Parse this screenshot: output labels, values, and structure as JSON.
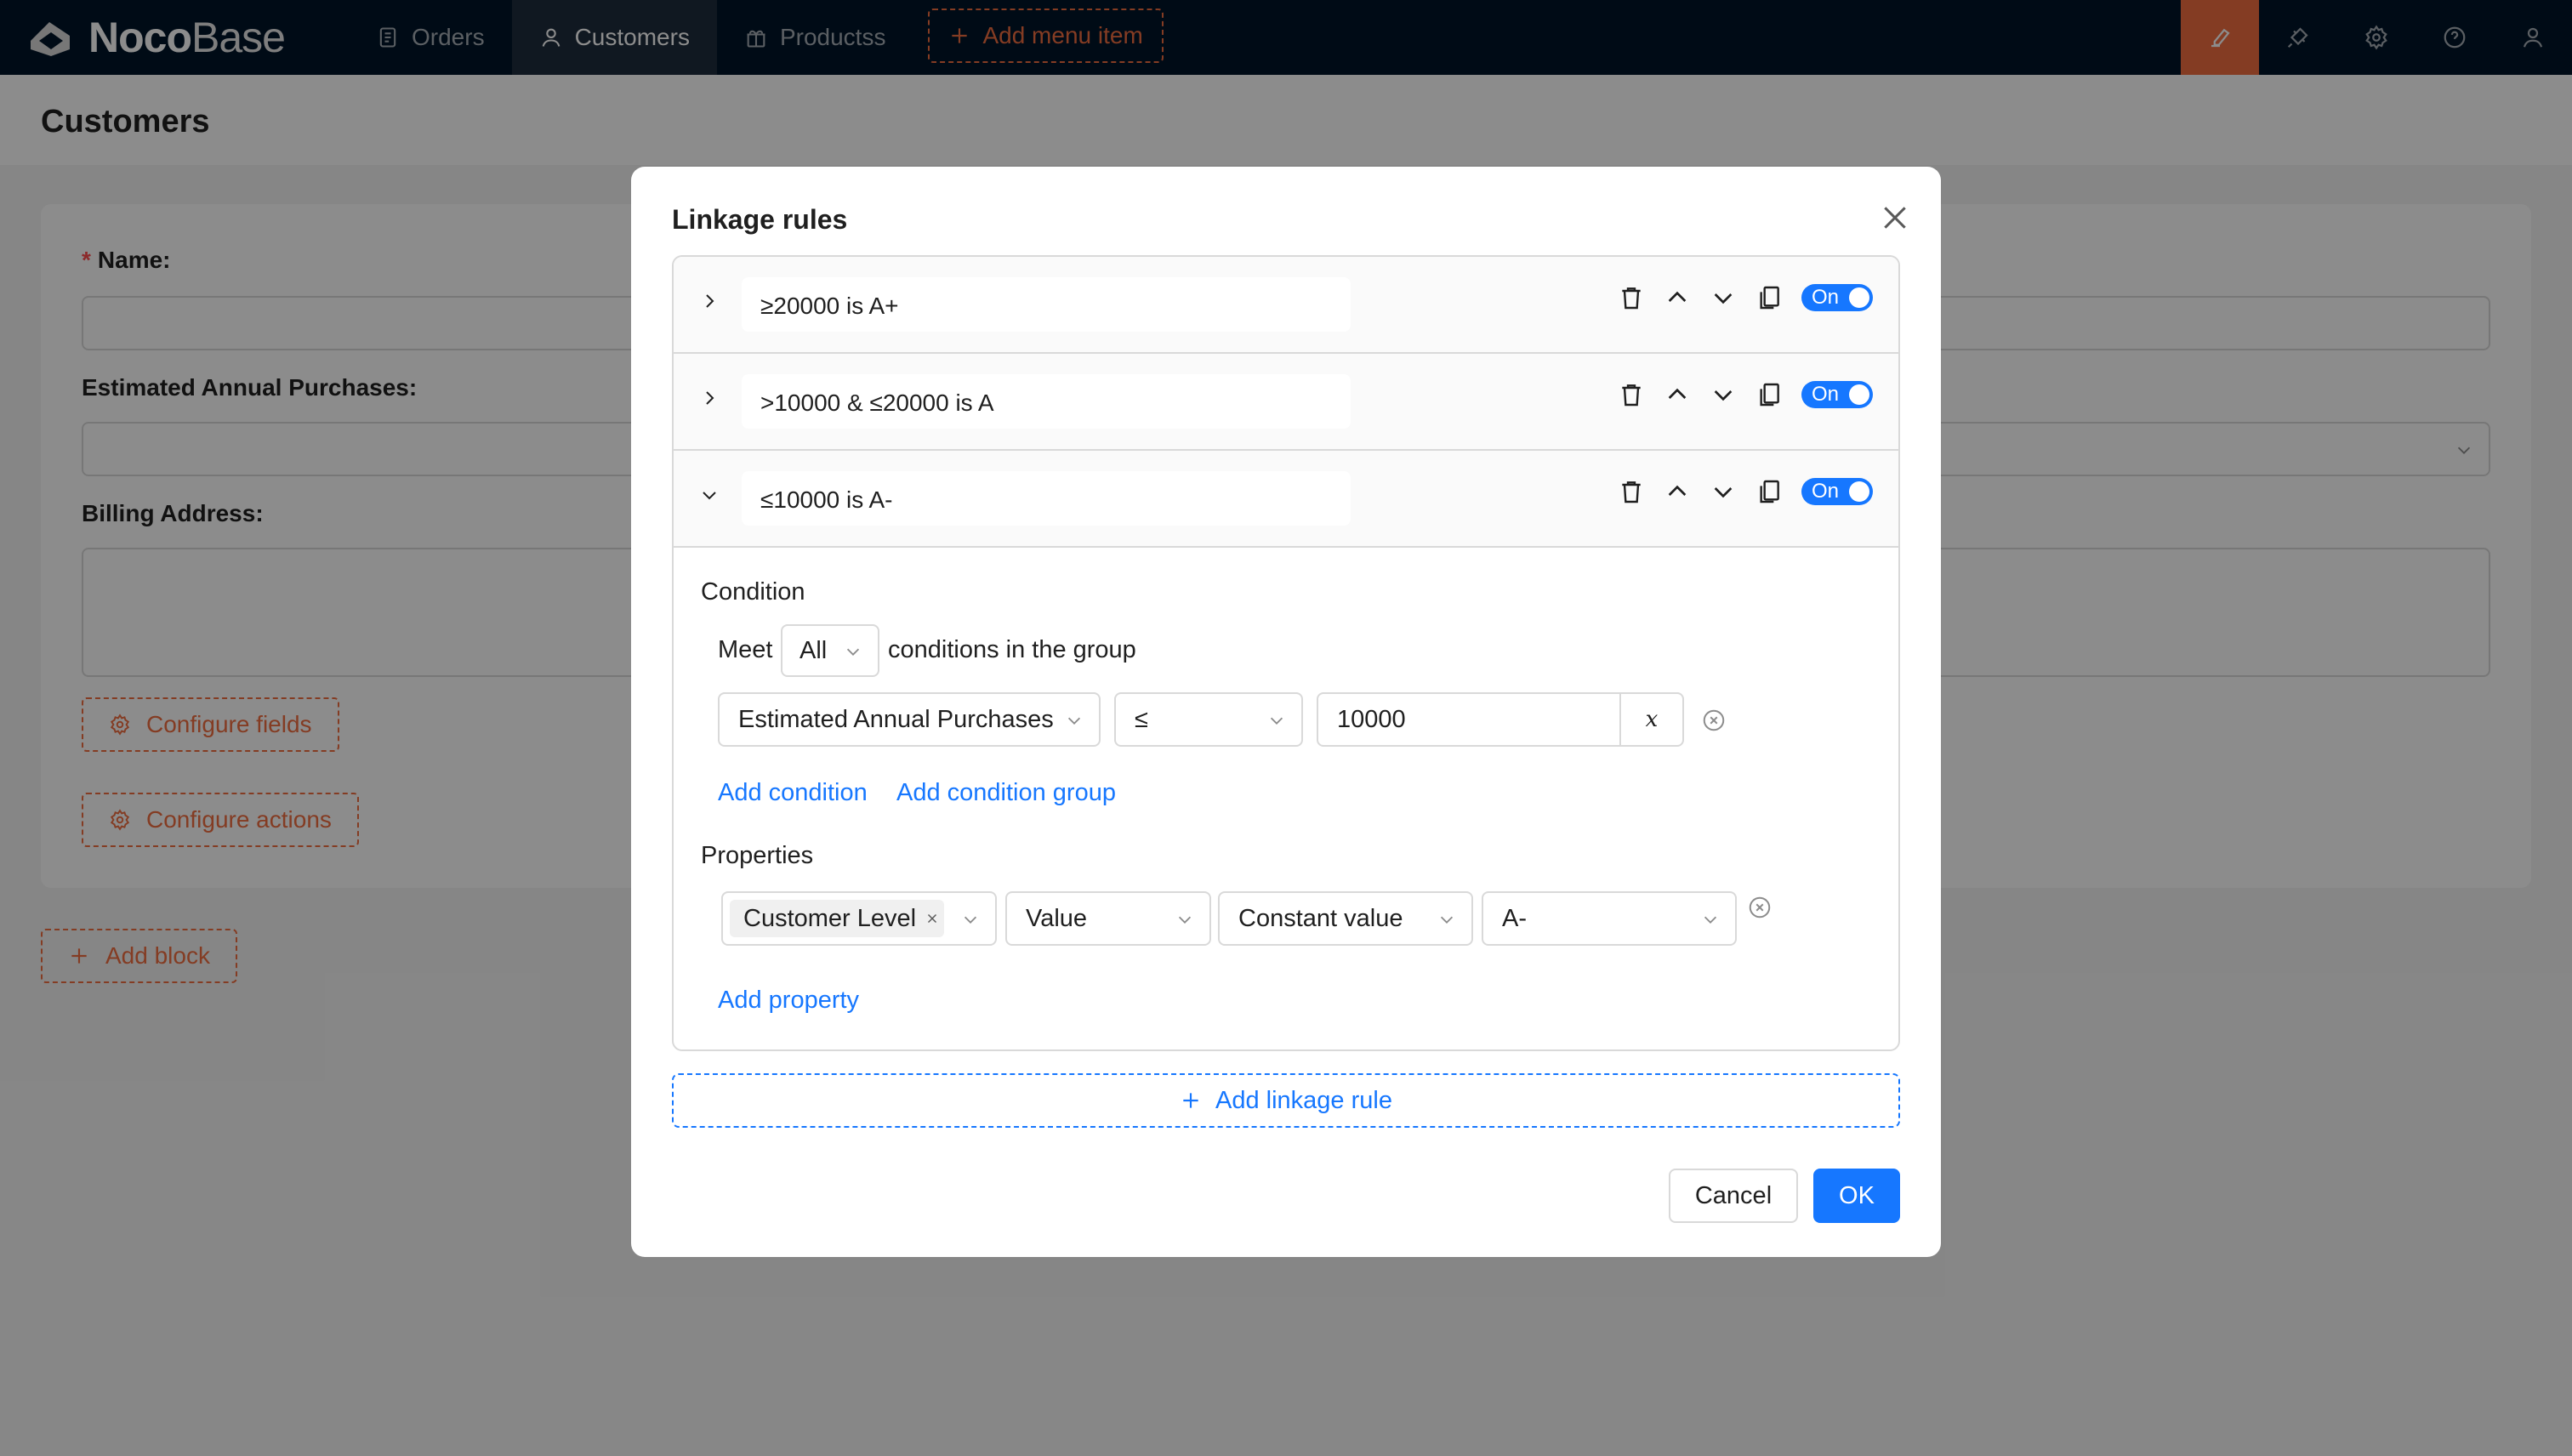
{
  "brand": {
    "name_bold": "Noco",
    "name_thin": "Base"
  },
  "nav": {
    "items": [
      {
        "label": "Orders",
        "icon": "file-icon",
        "active": false
      },
      {
        "label": "Customers",
        "icon": "user-icon",
        "active": true
      },
      {
        "label": "Productss",
        "icon": "gift-icon",
        "active": false
      }
    ],
    "add_menu_label": "Add menu item"
  },
  "top_right_icons": [
    "highlighter-icon",
    "plugin-icon",
    "settings-icon",
    "help-icon",
    "user-icon"
  ],
  "page": {
    "title": "Customers"
  },
  "form": {
    "fields": [
      {
        "label": "Name",
        "required": true
      },
      {
        "label": "Estimated Annual Purchases",
        "required": false
      },
      {
        "label": "Billing Address",
        "required": false
      }
    ],
    "configure_fields_label": "Configure fields",
    "configure_actions_label": "Configure actions",
    "add_block_label": "Add block"
  },
  "modal": {
    "title": "Linkage rules",
    "rules": [
      {
        "title": "≥20000 is A+",
        "expanded": false,
        "toggle": "On"
      },
      {
        "title": ">10000 & ≤20000 is A",
        "expanded": false,
        "toggle": "On"
      },
      {
        "title": "≤10000 is A-",
        "expanded": true,
        "toggle": "On"
      }
    ],
    "condition": {
      "heading": "Condition",
      "meet_prefix": "Meet",
      "meet_value": "All",
      "meet_suffix": "conditions in the group",
      "field": "Estimated Annual Purchases",
      "operator": "≤",
      "value": "10000",
      "variable_button": "x",
      "add_condition": "Add condition",
      "add_condition_group": "Add condition group"
    },
    "properties": {
      "heading": "Properties",
      "field_tag": "Customer Level",
      "action": "Value",
      "value_type": "Constant value",
      "value": "A-",
      "add_property": "Add property"
    },
    "add_rule_label": "Add linkage rule",
    "cancel_label": "Cancel",
    "ok_label": "OK"
  },
  "colors": {
    "brand_orange": "#f06d40",
    "primary_blue": "#1677ff",
    "topbar": "#001529"
  }
}
